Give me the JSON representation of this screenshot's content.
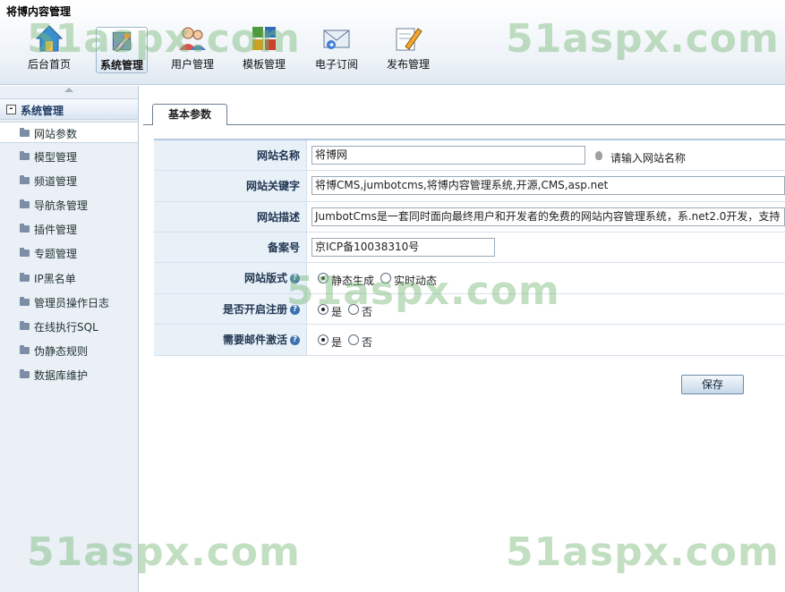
{
  "app": {
    "title": "将博内容管理"
  },
  "nav": [
    {
      "label": "后台首页",
      "icon": "home-icon"
    },
    {
      "label": "系统管理",
      "icon": "system-tools-icon",
      "active": true
    },
    {
      "label": "用户管理",
      "icon": "users-icon"
    },
    {
      "label": "模板管理",
      "icon": "template-puzzle-icon"
    },
    {
      "label": "电子订阅",
      "icon": "email-subscribe-icon"
    },
    {
      "label": "发布管理",
      "icon": "publish-pen-icon"
    }
  ],
  "sidebar": {
    "title": "系统管理",
    "toggle": "-",
    "items": [
      {
        "label": "网站参数",
        "active": true
      },
      {
        "label": "模型管理"
      },
      {
        "label": "频道管理"
      },
      {
        "label": "导航条管理"
      },
      {
        "label": "插件管理"
      },
      {
        "label": "专题管理"
      },
      {
        "label": "IP黑名单"
      },
      {
        "label": "管理员操作日志"
      },
      {
        "label": "在线执行SQL"
      },
      {
        "label": "伪静态规则"
      },
      {
        "label": "数据库维护"
      }
    ]
  },
  "tab": {
    "label": "基本参数"
  },
  "form": {
    "site_name": {
      "label": "网站名称",
      "value": "将博网",
      "hint": "请输入网站名称"
    },
    "keywords": {
      "label": "网站关键字",
      "value": "将博CMS,jumbotcms,将博内容管理系统,开源,CMS,asp.net"
    },
    "description": {
      "label": "网站描述",
      "value": "JumbotCms是一套同时面向最终用户和开发者的免费的网站内容管理系统，系.net2.0开发，支持"
    },
    "icp": {
      "label": "备案号",
      "value": "京ICP备10038310号"
    },
    "site_mode": {
      "label": "网站版式",
      "options": [
        "静态生成",
        "实时动态"
      ],
      "selected": "静态生成"
    },
    "register": {
      "label": "是否开启注册",
      "options": [
        "是",
        "否"
      ],
      "selected": "是"
    },
    "email_activate": {
      "label": "需要邮件激活",
      "options": [
        "是",
        "否"
      ],
      "selected": "是"
    }
  },
  "actions": {
    "save_label": "保存"
  },
  "watermark": {
    "text": "51aspx.com"
  },
  "colors": {
    "accent": "#3c71b0",
    "label_bg": "#e8f0f8",
    "sidebar_bg": "#eaf0f6"
  }
}
